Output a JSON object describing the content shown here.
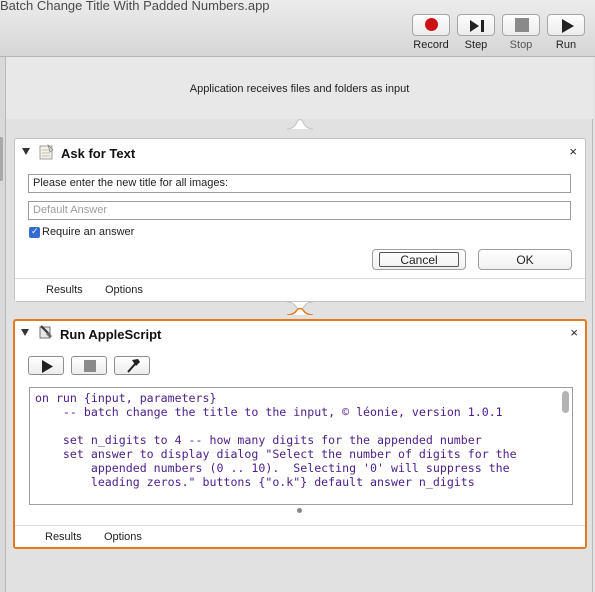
{
  "window": {
    "title": "Batch Change Title With Padded Numbers.app"
  },
  "toolbar": {
    "record_label": "Record",
    "step_label": "Step",
    "stop_label": "Stop",
    "run_label": "Run"
  },
  "workflow": {
    "input_header": "Application receives files and folders as input"
  },
  "ask_for_text": {
    "title": "Ask for Text",
    "close": "×",
    "prompt_value": "Please enter the new title for all images:",
    "default_answer_placeholder": "Default Answer",
    "require_answer_label": "Require an answer",
    "require_answer_checked": true,
    "cancel_label": "Cancel",
    "ok_label": "OK",
    "footer": {
      "results": "Results",
      "options": "Options"
    }
  },
  "run_applescript": {
    "title": "Run AppleScript",
    "close": "×",
    "code": "on run {input, parameters}\n    -- batch change the title to the input, © léonie, version 1.0.1\n\n    set n_digits to 4 -- how many digits for the appended number\n    set answer to display dialog \"Select the number of digits for the\n        appended numbers (0 .. 10).  Selecting '0' will suppress the\n        leading zeros.\" buttons {\"o.k\"} default answer n_digits",
    "footer": {
      "results": "Results",
      "options": "Options"
    }
  },
  "colors": {
    "selected_border": "#e37a1f",
    "record_red": "#cc1111",
    "code_text": "#4b1d8a"
  }
}
